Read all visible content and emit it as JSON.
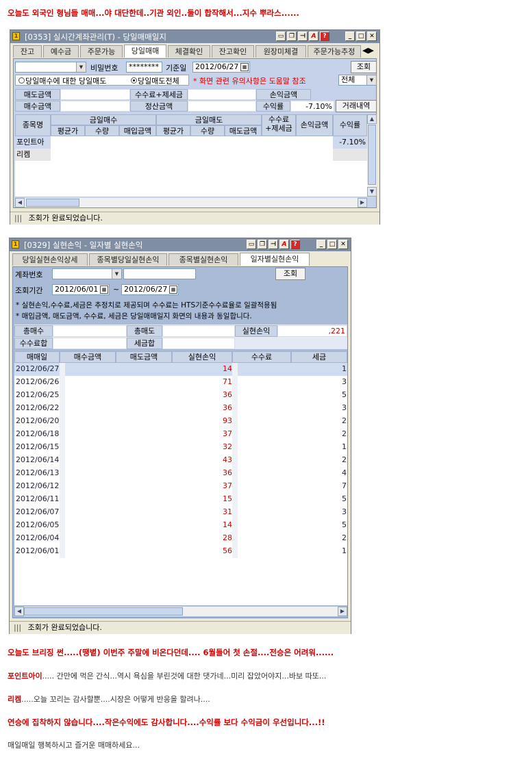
{
  "post": {
    "intro": "오늘도 외국인 형님들 매매...야 대단한데..기관 외인..둘이 합작해서...지수 뿌라스......",
    "outro1": "오늘도 브리징 썬.....(땡볕) 이번주 주말에 비온다던데.... 6월들어 첫 손절....전승은 어려워......",
    "outro2_name": "포인트아이",
    "outro2_text": "..... 간만에 먹은 간식...역시 욕심을 부린것에 대한 댓가네...미리 잡았어야지...바보 따또...",
    "outro3_name": "리켐",
    "outro3_text": ".....오늘 꼬리는 감사할뿐....시장은 어떻게 반응을 할려나....",
    "outro4": "연승에 집착하지 않습니다....작은수익에도 감사합니다....수익률 보다 수익금이 우선입니다...!!",
    "outro5": "매일매일 행복하시고 즐거운 매매하세요..."
  },
  "win1": {
    "title": "[0353] 실시간계좌관리(T) - 당일매매일지",
    "tabs": [
      "잔고",
      "예수금",
      "주문가능",
      "당일매매",
      "체결확인",
      "잔고확인",
      "원장미체결",
      "주문가능추정"
    ],
    "active_tab": 3,
    "password_label": "비밀번호",
    "password_value": "********",
    "date_label": "기준일",
    "date_value": "2012/06/27",
    "query_button": "조회",
    "radio1": "당일매수에 대한 당일매도",
    "radio2": "당일매도전체",
    "notice": "* 화면 관련 유의사항은 도움말 참조",
    "filter_value": "전체",
    "summary": {
      "sell_amount": "매도금액",
      "buy_amount": "매수금액",
      "fee_tax": "수수료+제세금",
      "settle": "정산금액",
      "pl_amount": "손익금액",
      "return_rate": "수익률",
      "return_value": "-7.10%",
      "history_button": "거래내역"
    },
    "grid_headers": {
      "stock": "종목명",
      "today_buy": "금일매수",
      "today_sell": "금일매도",
      "avg": "평균가",
      "qty": "수량",
      "buy_amt": "매입금액",
      "sell_amt": "매도금액",
      "fee": "수수료\n+제세금",
      "pl": "손익금액",
      "rate": "수익률"
    },
    "rows": [
      {
        "name": "포인트아",
        "rate": "-7.10%"
      },
      {
        "name": "리켐",
        "rate": ""
      }
    ],
    "status": "조회가 완료되었습니다."
  },
  "win2": {
    "title": "[0329] 실현손익 - 일자별 실현손익",
    "tabs": [
      "당일실현손익상세",
      "종목별당일실현손익",
      "종목별실현손익",
      "일자별실현손익"
    ],
    "active_tab": 3,
    "account_label": "계좌번호",
    "period_label": "조회기간",
    "date_from": "2012/06/01",
    "date_to": "2012/06/27",
    "query_button": "조회",
    "note1": "* 실현손익,수수료,세금은 추정치로 제공되며 수수료는 HTS기준수수료율로 일괄적용됨",
    "note2": "* 매입금액, 매도금액, 수수료, 세금은 당일매매일지 화면의 내용과 동일합니다.",
    "summary": {
      "total_buy": "총매수",
      "total_sell": "총매도",
      "realized": "실현손익",
      "realized_value": ",221",
      "fee_sum": "수수료합",
      "tax_sum": "세금합"
    },
    "headers": [
      "매매일",
      "매수금액",
      "매도금액",
      "실현손익",
      "수수료",
      "세금"
    ],
    "rows": [
      {
        "date": "2012/06/27",
        "pl": "14",
        "tax": "1"
      },
      {
        "date": "2012/06/26",
        "pl": "71",
        "tax": "3"
      },
      {
        "date": "2012/06/25",
        "pl": "36",
        "tax": "5"
      },
      {
        "date": "2012/06/22",
        "pl": "36",
        "tax": "3"
      },
      {
        "date": "2012/06/20",
        "pl": "93",
        "tax": "2"
      },
      {
        "date": "2012/06/18",
        "pl": "37",
        "tax": "2"
      },
      {
        "date": "2012/06/15",
        "pl": "32",
        "tax": "1"
      },
      {
        "date": "2012/06/14",
        "pl": "43",
        "tax": "2"
      },
      {
        "date": "2012/06/13",
        "pl": "36",
        "tax": "4"
      },
      {
        "date": "2012/06/12",
        "pl": "37",
        "tax": "7"
      },
      {
        "date": "2012/06/11",
        "pl": "15",
        "tax": "5"
      },
      {
        "date": "2012/06/07",
        "pl": "31",
        "tax": "3"
      },
      {
        "date": "2012/06/05",
        "pl": "14",
        "tax": "5"
      },
      {
        "date": "2012/06/04",
        "pl": "28",
        "tax": "2"
      },
      {
        "date": "2012/06/01",
        "pl": "56",
        "tax": "1"
      }
    ],
    "status": "조회가 완료되었습니다."
  }
}
